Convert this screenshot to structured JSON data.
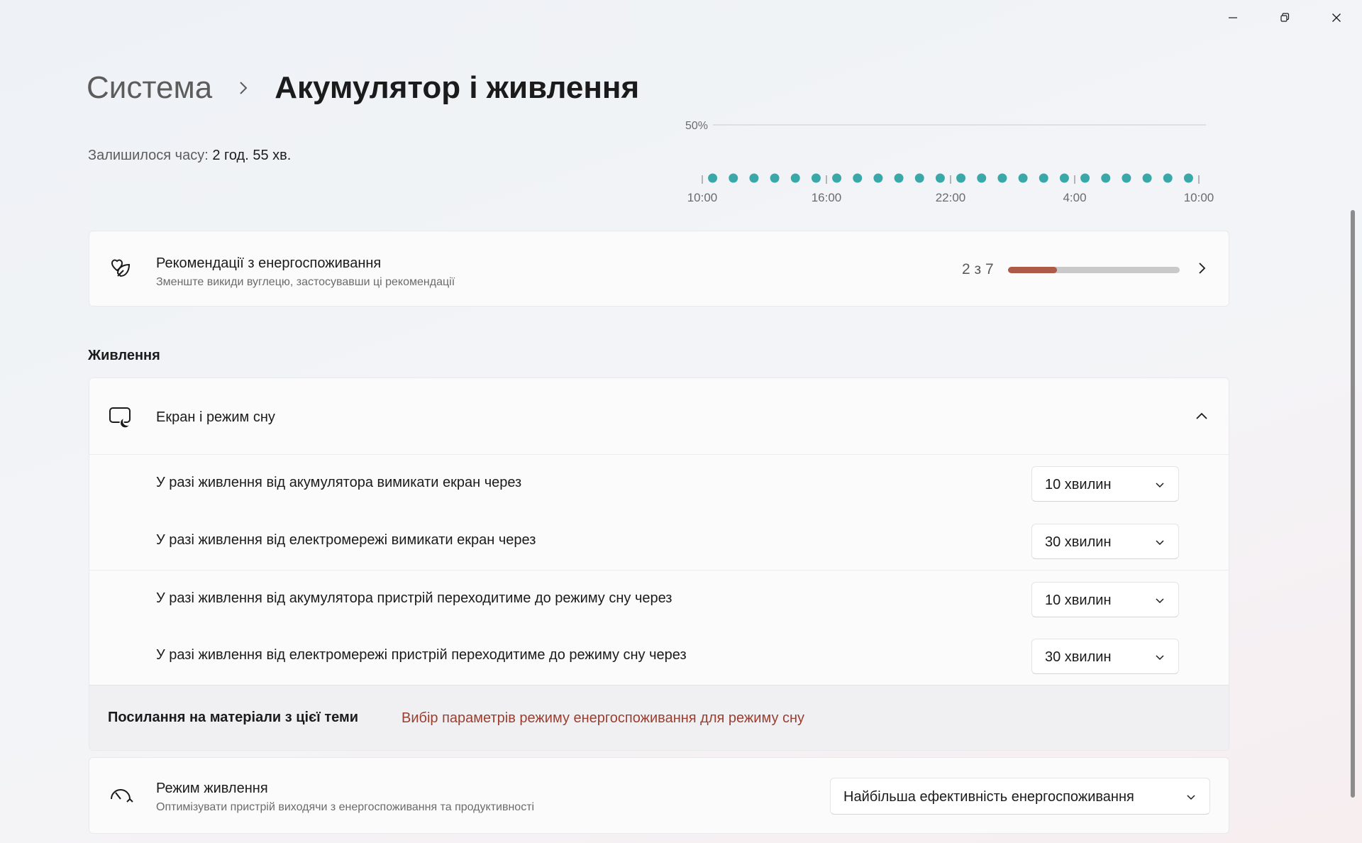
{
  "window": {
    "controls": {
      "minimize": "minimize-icon",
      "maximize": "restore-icon",
      "close": "close-icon"
    }
  },
  "breadcrumb": {
    "parent": "Система",
    "current": "Акумулятор і живлення"
  },
  "battery": {
    "time_left_label": "Залишилося часу:",
    "time_left_value": "2 год. 55 хв."
  },
  "chart_data": {
    "type": "scatter",
    "y_tick_label": "50%",
    "x_ticks": [
      "10:00",
      "16:00",
      "22:00",
      "4:00",
      "10:00"
    ],
    "x_range_hours": [
      0,
      24
    ],
    "x": [
      0.5,
      1.5,
      2.5,
      3.5,
      4.5,
      5.5,
      6.5,
      7.5,
      8.5,
      9.5,
      10.5,
      11.5,
      12.5,
      13.5,
      14.5,
      15.5,
      16.5,
      17.5,
      18.5,
      19.5,
      20.5,
      21.5,
      22.5,
      23.5
    ],
    "point_color": "#3aa8a8",
    "grid": true
  },
  "recommendations": {
    "icon": "leaf-heart-icon",
    "title": "Рекомендації з енергоспоживання",
    "subtitle": "Зменште викиди вуглецю, застосувавши ці рекомендації",
    "count_text": "2 з 7",
    "progress": 0.285,
    "progress_color": "#ad5a48"
  },
  "power_section": {
    "title": "Живлення",
    "screen_sleep": {
      "icon": "screen-sleep-icon",
      "title": "Екран і режим сну",
      "rows": [
        {
          "label": "У разі живлення від акумулятора вимикати екран через",
          "value": "10 хвилин"
        },
        {
          "label": "У разі живлення від електромережі вимикати екран через",
          "value": "30 хвилин"
        },
        {
          "label": "У разі живлення від акумулятора пристрій переходитиме до режиму сну через",
          "value": "10 хвилин"
        },
        {
          "label": "У разі живлення від електромережі пристрій переходитиме до режиму сну через",
          "value": "30 хвилин"
        }
      ],
      "related_label": "Посилання на матеріали з цієї теми",
      "related_link": "Вибір параметрів режиму енергоспоживання для режиму сну"
    },
    "power_mode": {
      "icon": "power-mode-gauge-icon",
      "title": "Режим живлення",
      "subtitle": "Оптимізувати пристрій виходячи з енергоспоживання та продуктивності",
      "value": "Найбільша ефективність енергоспоживання"
    }
  }
}
